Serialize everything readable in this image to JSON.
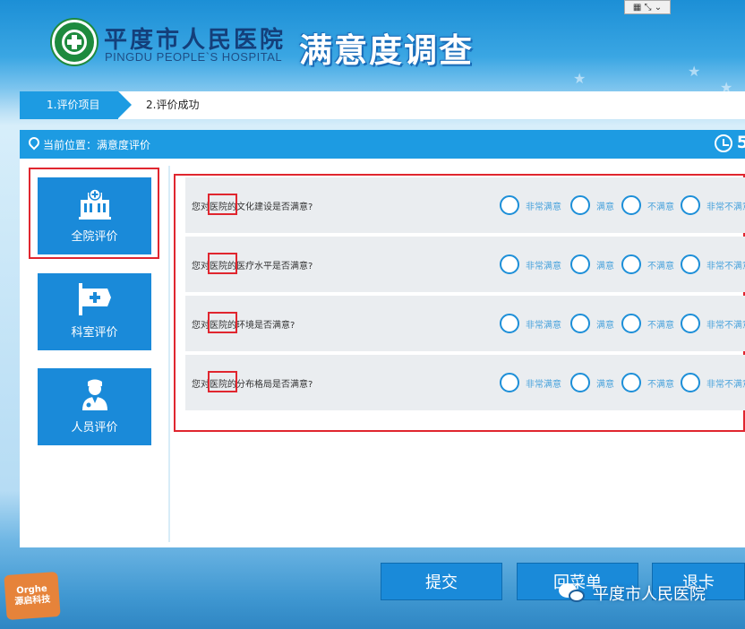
{
  "header": {
    "hospital_name": "平度市人民医院",
    "hospital_name_en": "PINGDU PEOPLE`S HOSPITAL",
    "survey_title": "满意度调查",
    "input_widget": "▦ ⤡ ⌄"
  },
  "steps": [
    {
      "label": "1.评价项目",
      "active": true
    },
    {
      "label": "2.评价成功",
      "active": false
    }
  ],
  "panel": {
    "location_label": "当前位置：满意度评价",
    "countdown": "5"
  },
  "sidebar": {
    "items": [
      {
        "label": "全院评价",
        "icon": "hospital-building-icon",
        "selected": true
      },
      {
        "label": "科室评价",
        "icon": "department-sign-icon",
        "selected": false
      },
      {
        "label": "人员评价",
        "icon": "doctor-icon",
        "selected": false
      }
    ]
  },
  "questions": [
    {
      "text": "您对医院的文化建设是否满意?"
    },
    {
      "text": "您对医院的医疗水平是否满意?"
    },
    {
      "text": "您对医院的环境是否满意?"
    },
    {
      "text": "您对医院的分布格局是否满意?"
    }
  ],
  "options": [
    "非常满意",
    "满意",
    "不满意",
    "非常不满意"
  ],
  "footer": {
    "submit_label": "提交",
    "menu_label": "回菜单",
    "exit_label": "退卡",
    "badge_line1": "Orghe",
    "badge_line2": "源启科技",
    "watermark_text": "平度市人民医院"
  },
  "colors": {
    "accent_blue": "#1d9be2",
    "highlight_red": "#e0262f",
    "logo_green": "#1e8a3e"
  }
}
